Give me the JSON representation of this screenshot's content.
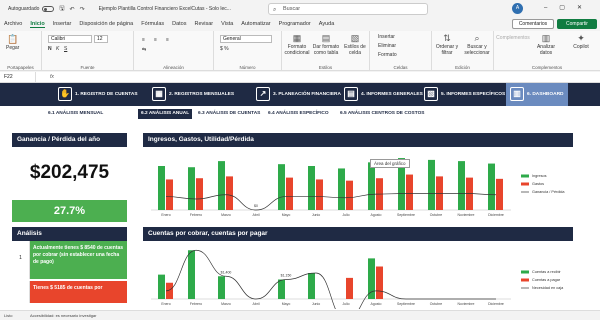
{
  "titlebar": {
    "autosave": "Autoguardado",
    "doc_title": "Ejemplo Plantilla Control Financiero ExcelCutas  -  Solo lec...",
    "search_placeholder": "Buscar",
    "avatar": "A"
  },
  "menu": [
    "Archivo",
    "Inicio",
    "Insertar",
    "Disposición de página",
    "Fórmulas",
    "Datos",
    "Revisar",
    "Vista",
    "Automatizar",
    "Programador",
    "Ayuda"
  ],
  "menu_active_index": 1,
  "comentarios": "Comentarios",
  "compartir": "Compartir",
  "ribbon": {
    "groups": [
      "Portapapeles",
      "Fuente",
      "Alineación",
      "Número",
      "Estilos",
      "Celdas",
      "Edición",
      "Complementos"
    ],
    "paste": "Pegar",
    "font_name": "Calibri",
    "font_size": "12",
    "number_format": "General",
    "cond_format": "Formato condicional",
    "table_format": "Dar formato como tabla",
    "cell_styles": "Estilos de celda",
    "insert": "Insertar",
    "delete": "Eliminar",
    "format": "Formato",
    "sort_filter": "Ordenar y filtrar",
    "find_select": "Buscar y seleccionar",
    "addins": "Complementos",
    "analyze": "Analizar datos",
    "copilot": "Copilot"
  },
  "formula_bar": {
    "cell_ref": "F22",
    "fx": "fx"
  },
  "nav": {
    "items": [
      "1. REGISTRO DE CUENTAS",
      "2. REGISTROS MENSUALES",
      "3. PLANEACIÓN FINANCIERA",
      "4. INFORMES GENERALES",
      "5. INFORMES ESPECÍFICOS",
      "6. DASHBOARD"
    ],
    "active_index": 5
  },
  "subnav": {
    "items": [
      "6.1 ANÁLISIS MENSUAL",
      "6.2 ANÁLISIS ANUAL",
      "6.3 ANÁLISIS DE CUENTAS",
      "6.4 ANÁLISIS ESPECÍFICO",
      "6.5 ANÁLISIS CENTROS DE COSTOS"
    ],
    "active_index": 1
  },
  "left": {
    "profit_title": "Ganancia / Pérdida del año",
    "profit_value": "$202,475",
    "pct_value": "27.7%",
    "analysis_title": "Análisis",
    "analysis_rows": [
      {
        "num": "1",
        "text": "Actualmente tienes $ 8540 de cuentas por cobrar (sin establecer una fecha de pago)"
      },
      {
        "num": "",
        "text": "Tienes $ 5185 de cuentas por"
      }
    ]
  },
  "tooltip": "Área del gráfico",
  "colors": {
    "income": "#2eaa4a",
    "expense": "#e8452c",
    "navy": "#1f2a44",
    "green_box": "#4caf50"
  },
  "chart_data": [
    {
      "type": "bar",
      "title": "Ingresos, Gastos, Utilidad/Pérdida",
      "categories": [
        "Enero",
        "Febrero",
        "Marzo",
        "Abril",
        "Mayo",
        "Junio",
        "Julio",
        "Agosto",
        "Septiembre",
        "Octubre",
        "Noviembre",
        "Diciembre"
      ],
      "series": [
        {
          "name": "Ingresos",
          "values": [
            72000,
            70000,
            80000,
            0,
            75000,
            72000,
            68000,
            78000,
            85000,
            82000,
            80000,
            76000
          ]
        },
        {
          "name": "Gastos",
          "values": [
            50000,
            52000,
            55000,
            0,
            53000,
            50000,
            48000,
            52000,
            58000,
            55000,
            53000,
            51000
          ]
        },
        {
          "name": "Ganancia / Pérdida",
          "values": [
            22000,
            18000,
            25000,
            0,
            22000,
            22000,
            20000,
            26000,
            27000,
            27000,
            27000,
            25000
          ]
        }
      ],
      "value_labels": {
        "3": "$0"
      },
      "legend": "right"
    },
    {
      "type": "bar",
      "title": "Cuentas por cobrar, cuentas por pagar",
      "categories": [
        "Enero",
        "Febrero",
        "Marzo",
        "Abril",
        "Mayo",
        "Junio",
        "Julio",
        "Agosto",
        "Septiembre",
        "Octubre",
        "Noviembre",
        "Diciembre"
      ],
      "series": [
        {
          "name": "Cuentas a recibir",
          "values": [
            1500,
            3000,
            1400,
            0,
            1200,
            1600,
            0,
            2500,
            0,
            0,
            0,
            0
          ]
        },
        {
          "name": "Cuentas a pagar",
          "values": [
            1000,
            0,
            0,
            0,
            0,
            0,
            1300,
            2000,
            0,
            0,
            0,
            0
          ]
        },
        {
          "name": "Necesidad en caja",
          "values": [
            500,
            3000,
            1400,
            0,
            1200,
            1600,
            -1300,
            500,
            0,
            0,
            0,
            0
          ]
        }
      ],
      "value_labels": {
        "2": "$1,400",
        "4": "$1,150"
      },
      "legend": "right"
    }
  ],
  "status": {
    "left": "Listo",
    "accessibility": "Accesibilidad: es necesario investigar"
  }
}
